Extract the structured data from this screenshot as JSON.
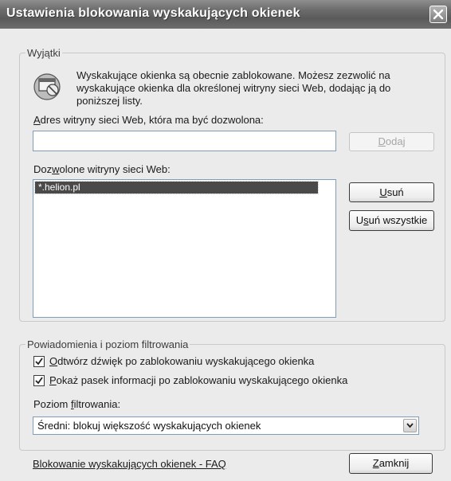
{
  "window": {
    "title": "Ustawienia blokowania wyskakujących okienek"
  },
  "exceptions": {
    "legend": "Wyjątki",
    "info_line1": "Wyskakujące okienka są obecnie zablokowane. Możesz zezwolić na",
    "info_line2": "wyskakujące okienka dla określonej witryny sieci Web, dodając ją do",
    "info_line3": "poniższej listy.",
    "address_label_hotkey": "A",
    "address_label_rest": "dres witryny sieci Web, która ma być dozwolona:",
    "address_value": "",
    "add_hotkey": "D",
    "add_rest": "odaj",
    "allowed_label_pre": "Doz",
    "allowed_label_hotkey": "w",
    "allowed_label_post": "olone witryny sieci Web:",
    "allowed_sites": [
      "*.helion.pl"
    ],
    "remove_hotkey": "U",
    "remove_rest": "suń",
    "remove_all_pre": "U",
    "remove_all_hotkey": "s",
    "remove_all_post": "uń wszystkie"
  },
  "notifications": {
    "legend": "Powiadomienia i poziom filtrowania",
    "sound_hotkey": "O",
    "sound_rest": "dtwórz dźwięk po zablokowaniu wyskakującego okienka",
    "sound_checked": true,
    "infobar_hotkey": "P",
    "infobar_rest": "okaż pasek informacji po zablokowaniu wyskakującego okienka",
    "infobar_checked": true,
    "filter_label_pre": "Poziom ",
    "filter_label_hotkey": "f",
    "filter_label_post": "iltrowania:",
    "filter_value": "Średni: blokuj większość wyskakujących okienek"
  },
  "footer": {
    "faq_link": "Blokowanie wyskakujących okienek - FAQ",
    "close_hotkey": "Z",
    "close_rest": "amknij"
  },
  "icons": {
    "close": "close-x-icon",
    "popup": "popup-blocker-icon",
    "check": "checkmark-icon",
    "dropdown": "chevron-down-icon"
  }
}
